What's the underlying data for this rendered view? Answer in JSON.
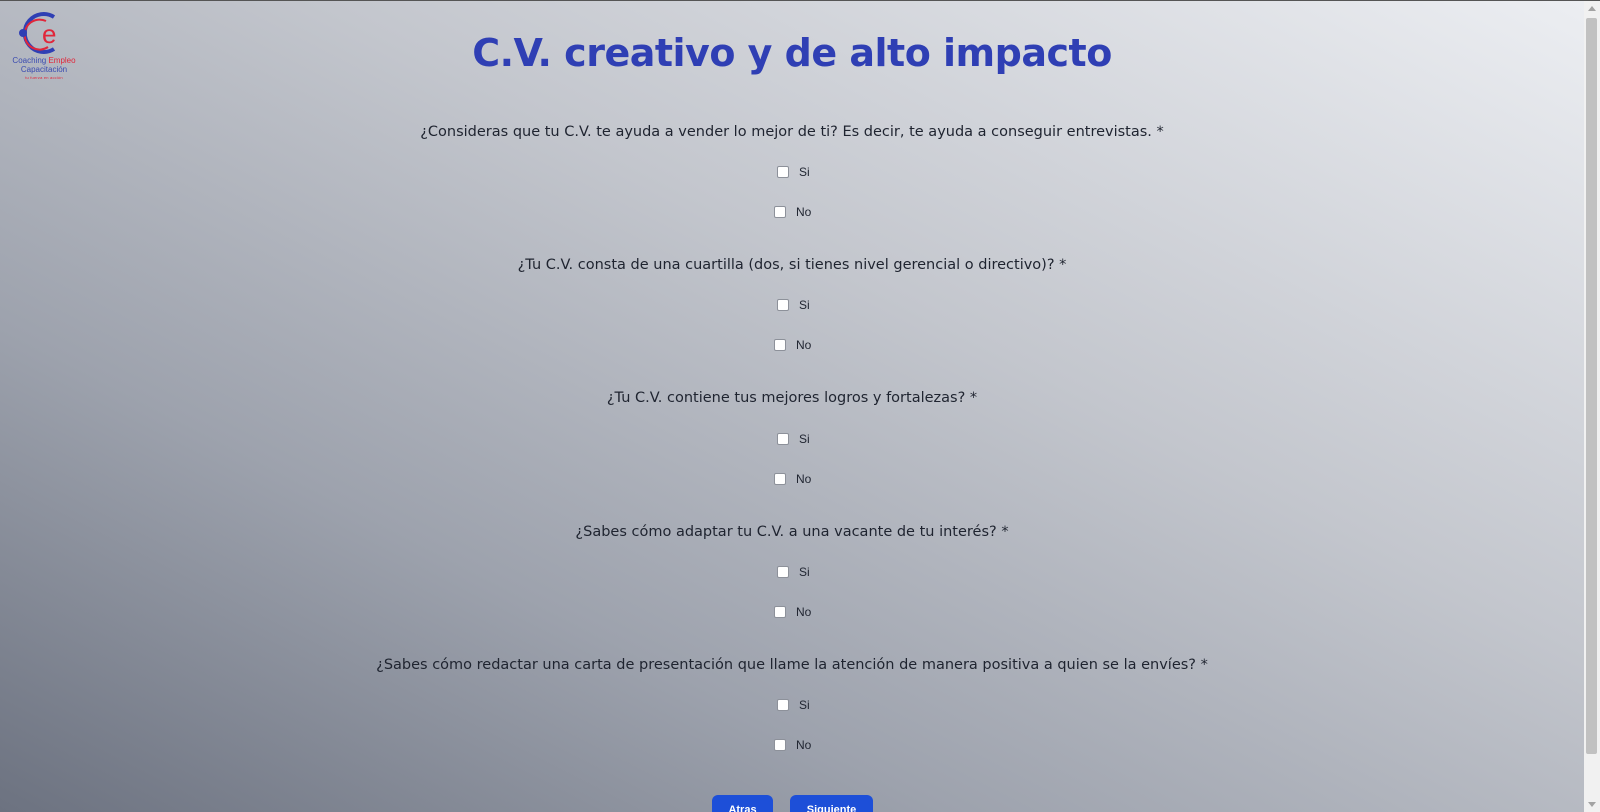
{
  "logo": {
    "line1_a": "Coaching ",
    "line1_b": "Empleo",
    "line2": "Capacitación",
    "line3": "tu fuerza en acción",
    "colors": {
      "blue": "#3a4bb0",
      "red": "#e0263a"
    }
  },
  "title": "C.V. creativo y de alto impacto",
  "questions": [
    {
      "text": "¿Consideras que tu C.V. te ayuda a vender lo mejor de ti? Es decir, te ayuda a conseguir entrevistas. *",
      "options": [
        "Si",
        "No"
      ]
    },
    {
      "text": "¿Tu C.V. consta de una cuartilla (dos, si tienes nivel gerencial o directivo)? *",
      "options": [
        "Si",
        "No"
      ]
    },
    {
      "text": "¿Tu C.V. contiene tus mejores logros y fortalezas? *",
      "options": [
        "Si",
        "No"
      ]
    },
    {
      "text": "¿Sabes cómo adaptar tu C.V. a una vacante de tu interés? *",
      "options": [
        "Si",
        "No"
      ]
    },
    {
      "text": "¿Sabes cómo redactar una carta de presentación que llame la atención de manera positiva a quien se la envíes? *",
      "options": [
        "Si",
        "No"
      ]
    }
  ],
  "buttons": {
    "back": "Atras",
    "next": "Siguiente"
  },
  "colors": {
    "title": "#2f3fb4",
    "button": "#1d4fd8"
  }
}
